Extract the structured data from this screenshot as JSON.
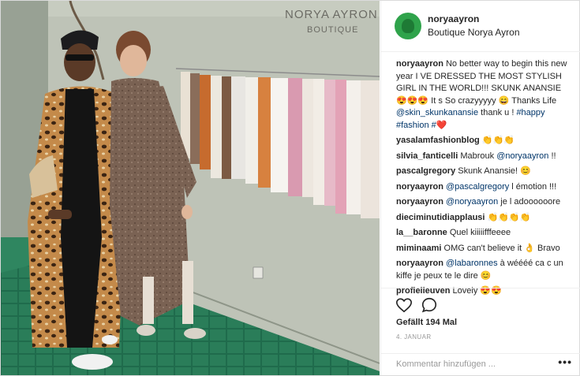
{
  "post": {
    "username": "noryaayron",
    "location": "Boutique Norya Ayron",
    "sign_line1": "NORYA AYRON",
    "sign_line2": "BOUTIQUE"
  },
  "comments": [
    {
      "user": "noryaayron",
      "text": "No better way to begin this new year I VE DRESSED THE MOST STYLISH GIRL IN THE WORLD!!! SKUNK ANANSIE 😍😍😍 It s So crazyyyyy 😄 Thanks Life ",
      "mention": "@skin_skunkanansie",
      "text2": " thank u ! ",
      "tags": "#happy #fashion #",
      "tail": "❤️"
    },
    {
      "user": "yasalamfashionblog",
      "text": "👏👏👏",
      "mention": "",
      "text2": "",
      "tags": "",
      "tail": ""
    },
    {
      "user": "silvia_fanticelli",
      "text": "Mabrouk ",
      "mention": "@noryaayron",
      "text2": " !!",
      "tags": "",
      "tail": ""
    },
    {
      "user": "pascalgregory",
      "text": "Skunk Anansie! 😊",
      "mention": "",
      "text2": "",
      "tags": "",
      "tail": ""
    },
    {
      "user": "noryaayron",
      "text": "",
      "mention": "@pascalgregory",
      "text2": " l émotion !!!",
      "tags": "",
      "tail": ""
    },
    {
      "user": "noryaayron",
      "text": "",
      "mention": "@noryaayron",
      "text2": " je l adoooooore",
      "tags": "",
      "tail": ""
    },
    {
      "user": "dieciminutidiapplausi",
      "text": "👏👏👏👏",
      "mention": "",
      "text2": "",
      "tags": "",
      "tail": ""
    },
    {
      "user": "la__baronne",
      "text": "Quel kiiiiifffeeee",
      "mention": "",
      "text2": "",
      "tags": "",
      "tail": ""
    },
    {
      "user": "miminaami",
      "text": "OMG can't believe it 👌 Bravo",
      "mention": "",
      "text2": "",
      "tags": "",
      "tail": ""
    },
    {
      "user": "noryaayron",
      "text": "",
      "mention": "@labaronnes",
      "text2": " à wéééé ca c un kiffe je peux te le dire 😊",
      "tags": "",
      "tail": ""
    },
    {
      "user": "profielleuven",
      "text": "Lovely 😍😍",
      "mention": "",
      "text2": "",
      "tags": "",
      "tail": ""
    }
  ],
  "actions": {
    "like_icon": "heart-icon",
    "comment_icon": "comment-bubble-icon",
    "likes": "Gefällt 194 Mal",
    "date": "4. JANUAR",
    "add_comment_placeholder": "Kommentar hinzufügen ...",
    "more_label": "•••"
  },
  "colors": {
    "avatar": "#2fa34b",
    "link": "#003569",
    "wall": "#b9bfb2",
    "floor": "#1f6b4c"
  }
}
